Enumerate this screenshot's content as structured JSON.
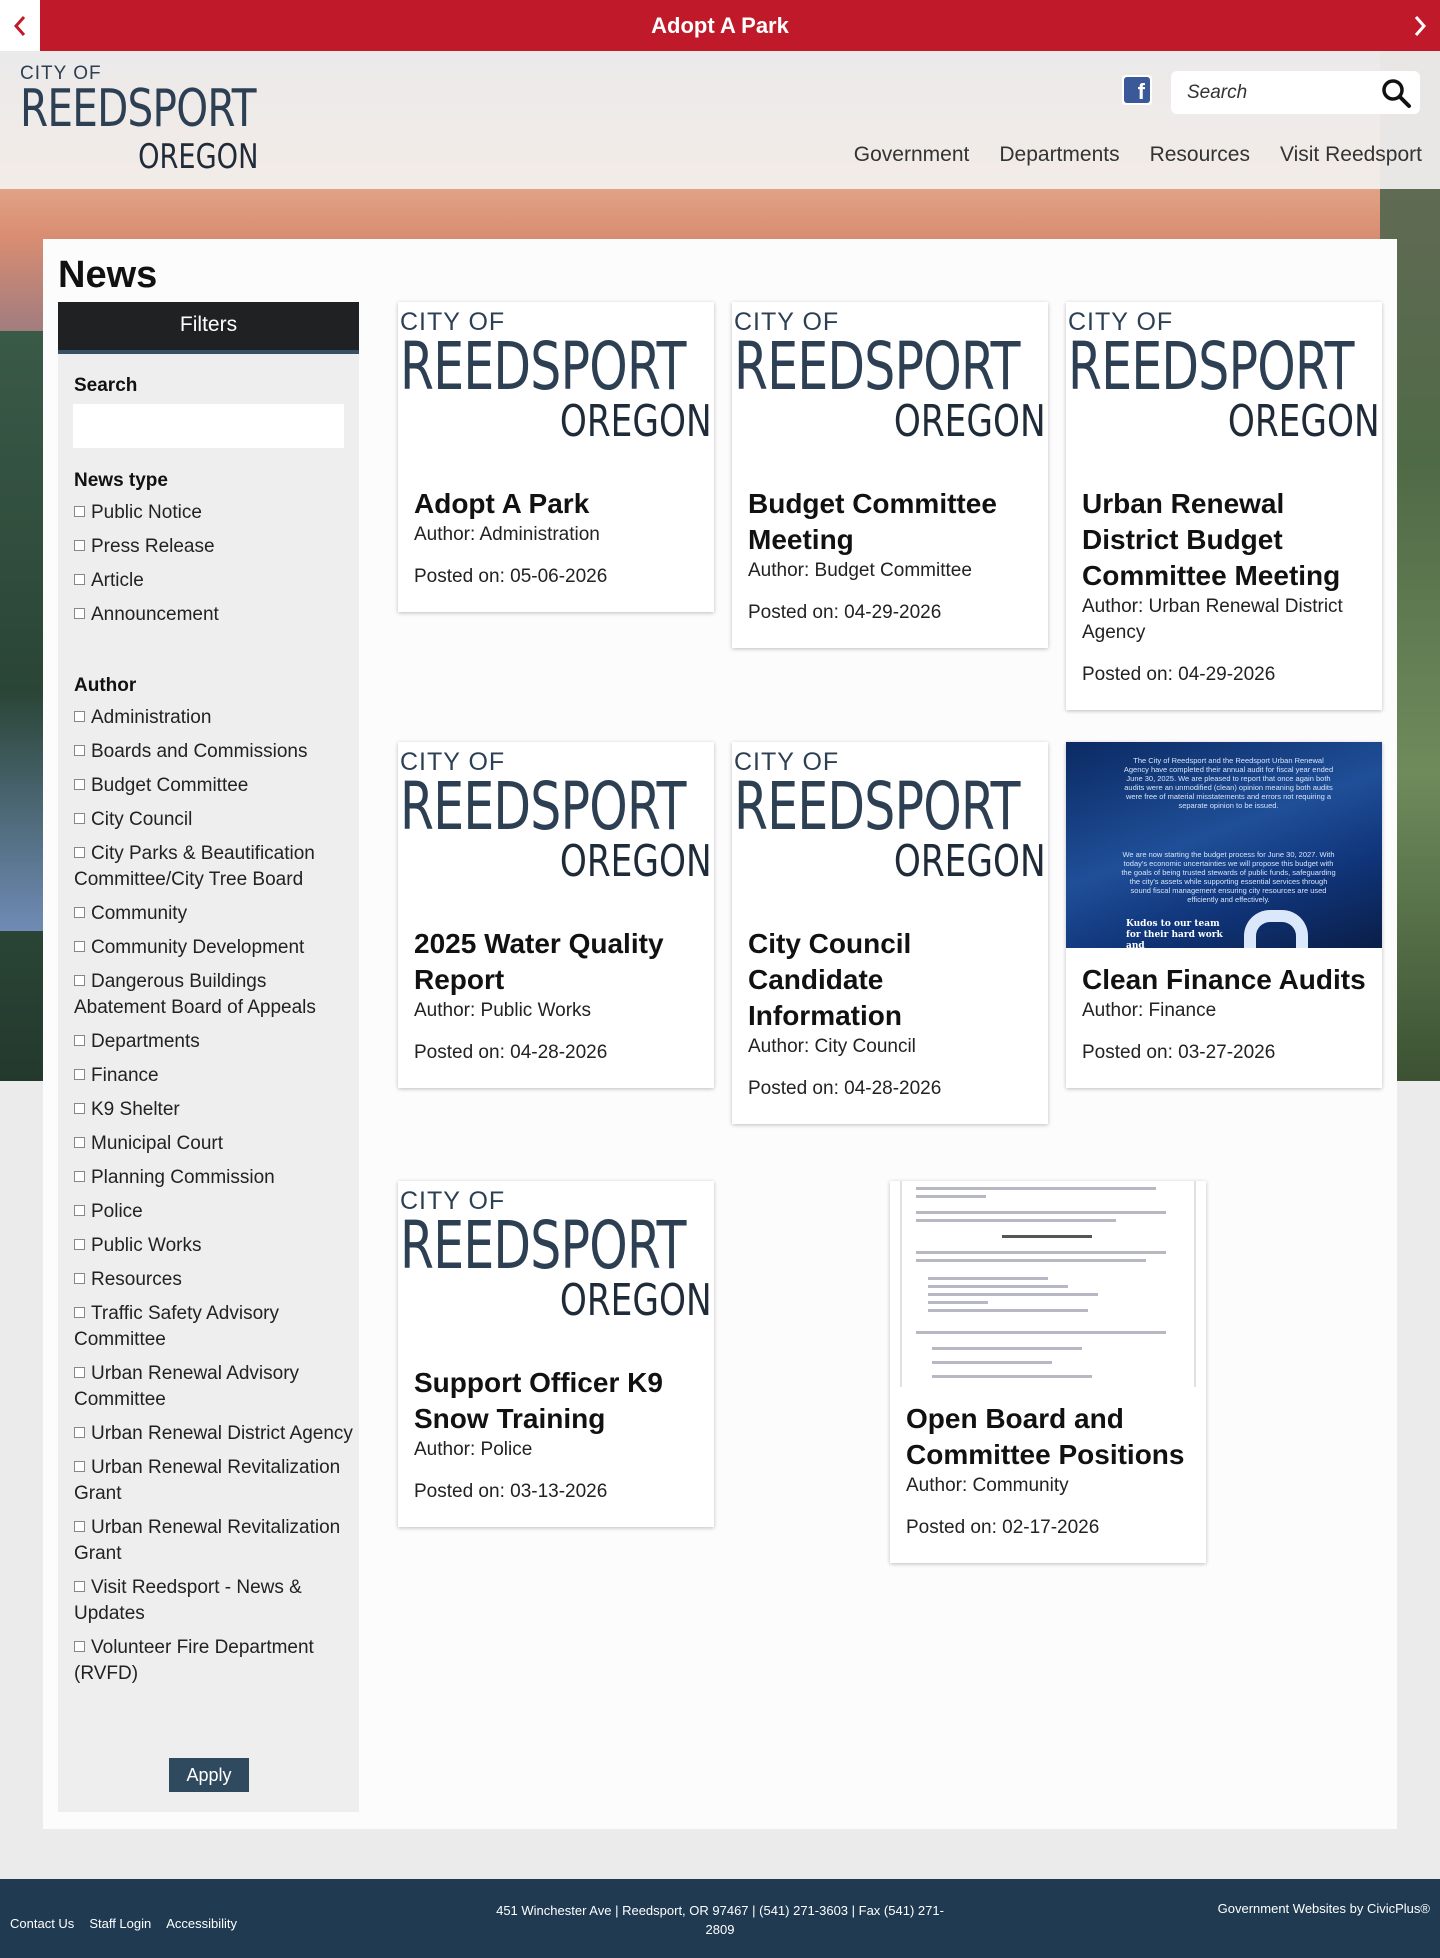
{
  "alert": {
    "title": "Adopt A Park"
  },
  "header": {
    "logo": {
      "city_of": "CITY OF",
      "name": "REEDSPORT",
      "state": "OREGON"
    },
    "search_placeholder": "Search",
    "nav": [
      "Government",
      "Departments",
      "Resources",
      "Visit Reedsport"
    ]
  },
  "page": {
    "title": "News"
  },
  "filters": {
    "heading": "Filters",
    "search_label": "Search",
    "news_type_label": "News type",
    "news_types": [
      "Public Notice",
      "Press Release",
      "Article",
      "Announcement"
    ],
    "author_label": "Author",
    "authors": [
      "Administration",
      "Boards and Commissions",
      "Budget Committee",
      "City Council",
      "City Parks & Beautification Committee/City Tree Board",
      "Community",
      "Community Development",
      "Dangerous Buildings Abatement Board of Appeals",
      "Departments",
      "Finance",
      "K9 Shelter",
      "Municipal Court",
      "Planning Commission",
      "Police",
      "Public Works",
      "Resources",
      "Traffic Safety Advisory Committee",
      "Urban Renewal Advisory Committee",
      "Urban Renewal District Agency",
      "Urban Renewal Revitalization Grant",
      "Urban Renewal Revitalization Grant",
      "Visit Reedsport - News & Updates",
      "Volunteer Fire Department (RVFD)"
    ],
    "apply_label": "Apply"
  },
  "cards": [
    {
      "title": "Adopt A Park",
      "author": "Author: Administration",
      "date": "Posted on: 05-06-2026"
    },
    {
      "title": "Budget Committee Meeting",
      "author": "Author: Budget Committee",
      "date": "Posted on: 04-29-2026"
    },
    {
      "title": "Urban Renewal District Budget Committee Meeting",
      "author": "Author: Urban Renewal District Agency",
      "date": "Posted on: 04-29-2026"
    },
    {
      "title": "2025 Water Quality Report",
      "author": "Author: Public Works",
      "date": "Posted on: 04-28-2026"
    },
    {
      "title": "City Council Candidate Information",
      "author": "Author: City Council",
      "date": "Posted on: 04-28-2026"
    },
    {
      "title": "Clean Finance Audits",
      "author": "Author: Finance",
      "date": "Posted on: 03-27-2026"
    },
    {
      "title": "Support Officer K9 Snow Training",
      "author": "Author: Police",
      "date": "Posted on: 03-13-2026"
    },
    {
      "title": "Open Board and Committee Positions",
      "author": "Author: Community",
      "date": "Posted on: 02-17-2026"
    }
  ],
  "finance_image": {
    "text1": "The City of Reedsport and the Reedsport Urban Renewal Agency have completed their annual audit for fiscal year ended June 30, 2025. We are pleased to report that once again both audits were an unmodified (clean) opinion meaning both audits were free of material misstatements and errors not requiring a separate opinion to be issued.",
    "text2": "We are now starting the budget process for June 30, 2027. With today's economic uncertainties we will propose this budget with the goals of being trusted stewards of public funds, safeguarding the city's assets while supporting essential services through sound fiscal management ensuring city resources are used efficiently and effectively.",
    "kudos": "Kudos to our team for their hard work and"
  },
  "footer": {
    "links": [
      "Contact Us",
      "Staff Login",
      "Accessibility"
    ],
    "address": "451 Winchester Ave | Reedsport, OR 97467 | (541) 271-3603 | Fax (541) 271-2809",
    "credit": "Government Websites by CivicPlus®"
  }
}
